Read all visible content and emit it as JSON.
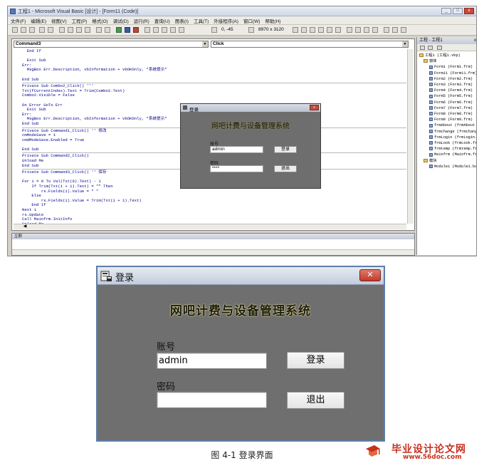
{
  "ide": {
    "title": "工程1 - Microsoft Visual Basic [设计] - [Form11 (Code)]",
    "menu": [
      "文件(F)",
      "编辑(E)",
      "视图(V)",
      "工程(P)",
      "格式(O)",
      "调试(D)",
      "运行(R)",
      "查询(U)",
      "图表(I)",
      "工具(T)",
      "外接程序(A)",
      "窗口(W)",
      "帮助(H)"
    ],
    "coords": "0, -45",
    "size": "8970 x 3120",
    "object_combo": "Command3",
    "proc_combo": "Click",
    "code_lines": [
      {
        "t": "  End If",
        "c": false
      },
      {
        "t": "",
        "c": false
      },
      {
        "t": "  Exit Sub",
        "c": false
      },
      {
        "t": "Err:",
        "c": false
      },
      {
        "t": "  MsgBox Err.Description, vbInformation + vbOKOnly, \"系统提示\"",
        "c": false
      },
      {
        "t": "",
        "c": false
      },
      {
        "t": "End Sub",
        "c": false
      },
      {
        "sep": true
      },
      {
        "t": "Private Sub Combo2_Click() '''",
        "c": false
      },
      {
        "t": "Txt(fCurrentIndex).Text = Trim(Combo2.Text)",
        "c": false
      },
      {
        "t": "Combo2.Visible = False",
        "c": false
      },
      {
        "t": "",
        "c": false
      },
      {
        "t": "On Error GoTo Err",
        "c": false
      },
      {
        "t": "  Exit Sub",
        "c": false
      },
      {
        "t": "Err:",
        "c": false
      },
      {
        "t": "  MsgBox Err.Description, vbInformation + vbOKOnly, \"系统提示\"",
        "c": false
      },
      {
        "t": "End Sub",
        "c": false
      },
      {
        "sep": true
      },
      {
        "t": "Private Sub Command1_Click() '' 修改",
        "c": false
      },
      {
        "t": "cmModeSave = 1",
        "c": false
      },
      {
        "t": "cmdModeSave.Enabled = True",
        "c": false
      },
      {
        "t": "",
        "c": false
      },
      {
        "t": "End Sub",
        "c": false
      },
      {
        "sep": true
      },
      {
        "t": "Private Sub Command2_Click()",
        "c": false
      },
      {
        "t": "Unload Me",
        "c": false
      },
      {
        "t": "End Sub",
        "c": false
      },
      {
        "sep": true
      },
      {
        "t": "Private Sub Command3_Click() '' 保存",
        "c": false
      },
      {
        "t": "",
        "c": false
      },
      {
        "t": "For i = 0 To Val(Txt(0).Text) - 1",
        "c": false
      },
      {
        "t": "    If Trim(Txt(i + 1).Text) = \"\" Then",
        "c": false
      },
      {
        "t": "        rs.Fields(i).Value = \" \"",
        "c": false
      },
      {
        "t": "    Else",
        "c": false
      },
      {
        "t": "        rs.Fields(i).Value = Trim(Txt(i + 1).Text)",
        "c": false
      },
      {
        "t": "    End If",
        "c": false
      },
      {
        "t": "Next i",
        "c": false
      },
      {
        "t": "rs.Update",
        "c": false
      },
      {
        "t": "Call Mainfrm.InitInfo",
        "c": false
      },
      {
        "t": "Unload Me",
        "c": false
      }
    ],
    "immediate_title": "立即",
    "project": {
      "title": "工程 - 工程1",
      "tree": [
        {
          "level": 0,
          "kind": "folder",
          "text": "工程1 (工程1.vbp)"
        },
        {
          "level": 1,
          "kind": "folder",
          "text": "窗体"
        },
        {
          "level": 2,
          "kind": "form",
          "text": "Form1 (Form1.frm)"
        },
        {
          "level": 2,
          "kind": "form",
          "text": "Form11 (Form11.frm)"
        },
        {
          "level": 2,
          "kind": "form",
          "text": "Form2 (Form2.frm)"
        },
        {
          "level": 2,
          "kind": "form",
          "text": "Form3 (Form3.frm)"
        },
        {
          "level": 2,
          "kind": "form",
          "text": "Form4 (Form4.frm)"
        },
        {
          "level": 2,
          "kind": "form",
          "text": "Form5 (Form5.frm)"
        },
        {
          "level": 2,
          "kind": "form",
          "text": "Form6 (Form6.frm)"
        },
        {
          "level": 2,
          "kind": "form",
          "text": "Form7 (Form7.frm)"
        },
        {
          "level": 2,
          "kind": "form",
          "text": "Form8 (Form8.frm)"
        },
        {
          "level": 2,
          "kind": "form",
          "text": "Form9 (Form9.frm)"
        },
        {
          "level": 2,
          "kind": "form",
          "text": "frmAbout (frmAbout"
        },
        {
          "level": 2,
          "kind": "form",
          "text": "frmchange (frmchang"
        },
        {
          "level": 2,
          "kind": "form",
          "text": "frmLogin (frmLogin."
        },
        {
          "level": 2,
          "kind": "form",
          "text": "frmLook (frmLook.fr"
        },
        {
          "level": 2,
          "kind": "form",
          "text": "frmtemp (frmtemp.fr"
        },
        {
          "level": 2,
          "kind": "form",
          "text": "Mainfrm (Mainfrm.fr"
        },
        {
          "level": 1,
          "kind": "folder",
          "text": "模块"
        },
        {
          "level": 2,
          "kind": "form",
          "text": "Module1 (Module1.bas"
        }
      ]
    }
  },
  "mini_login": {
    "title": "登录",
    "heading": "网吧计费与设备管理系统",
    "account_label": "账号",
    "account_value": "admin",
    "password_label": "密码",
    "password_value": "****",
    "login_btn": "登录",
    "exit_btn": "退出"
  },
  "login": {
    "title": "登录",
    "close": "✕",
    "heading": "网吧计费与设备管理系统",
    "account_label": "账号",
    "account_value": "admin",
    "password_label": "密码",
    "password_value": "",
    "login_btn": "登录",
    "exit_btn": "退出"
  },
  "caption": "图 4-1    登录界面",
  "watermark": {
    "title": "毕业设计论文网",
    "url": "www.56doc.com"
  },
  "colors": {
    "form_bg": "#6f6f6f",
    "heading_glow": "#f0e6a0",
    "close_btn": "#c03a2c",
    "watermark": "#c8311f"
  }
}
